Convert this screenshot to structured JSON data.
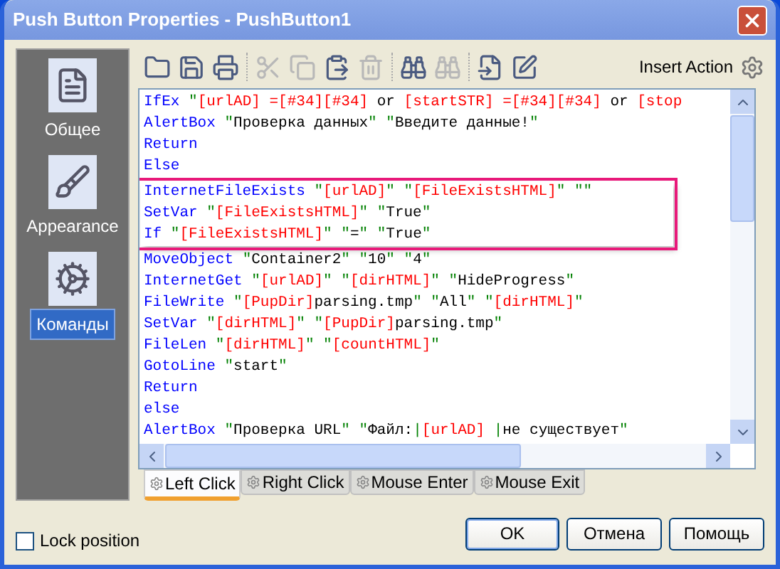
{
  "window": {
    "title": "Push Button Properties - PushButton1"
  },
  "sidebar": {
    "items": [
      {
        "label": "Общее",
        "kind": "general",
        "selected": false
      },
      {
        "label": "Appearance",
        "kind": "appearance",
        "selected": false
      },
      {
        "label": "Команды",
        "kind": "commands",
        "selected": true
      }
    ]
  },
  "toolbar": {
    "tools": [
      {
        "kind": "open",
        "disabled": false
      },
      {
        "kind": "save",
        "disabled": false
      },
      {
        "kind": "print",
        "disabled": false
      },
      {
        "kind": "sep"
      },
      {
        "kind": "cut",
        "disabled": true
      },
      {
        "kind": "copy",
        "disabled": true
      },
      {
        "kind": "paste",
        "disabled": false
      },
      {
        "kind": "delete",
        "disabled": true
      },
      {
        "kind": "sep"
      },
      {
        "kind": "find",
        "disabled": false
      },
      {
        "kind": "replace",
        "disabled": true
      },
      {
        "kind": "sep"
      },
      {
        "kind": "insert",
        "disabled": false
      },
      {
        "kind": "edit",
        "disabled": false
      }
    ],
    "insert_action": "Insert Action"
  },
  "editor": {
    "lines": [
      {
        "highlighted": false,
        "tokens": [
          {
            "kind": "kw",
            "text": "IfEx "
          },
          {
            "kind": "q",
            "text": "\""
          },
          {
            "kind": "v",
            "text": "[urlAD] =[#34][#34] "
          },
          {
            "kind": "t",
            "text": "or "
          },
          {
            "kind": "v",
            "text": "[startSTR] =[#34][#34] "
          },
          {
            "kind": "t",
            "text": "or "
          },
          {
            "kind": "v",
            "text": "[stop"
          }
        ]
      },
      {
        "highlighted": false,
        "tokens": [
          {
            "kind": "kw",
            "text": "AlertBox "
          },
          {
            "kind": "q",
            "text": "\""
          },
          {
            "kind": "t",
            "text": "Проверка данных"
          },
          {
            "kind": "q",
            "text": "\" \""
          },
          {
            "kind": "t",
            "text": "Введите данные!"
          },
          {
            "kind": "q",
            "text": "\""
          }
        ]
      },
      {
        "highlighted": false,
        "tokens": [
          {
            "kind": "kw",
            "text": "Return"
          }
        ]
      },
      {
        "highlighted": false,
        "tokens": [
          {
            "kind": "kw",
            "text": "Else"
          }
        ]
      },
      {
        "highlighted": true,
        "tokens": [
          {
            "kind": "kw",
            "text": "InternetFileExists "
          },
          {
            "kind": "q",
            "text": "\""
          },
          {
            "kind": "v",
            "text": "[urlAD]"
          },
          {
            "kind": "q",
            "text": "\" \""
          },
          {
            "kind": "v",
            "text": "[FileExistsHTML]"
          },
          {
            "kind": "q",
            "text": "\" \"\""
          }
        ]
      },
      {
        "highlighted": true,
        "tokens": [
          {
            "kind": "kw",
            "text": "SetVar "
          },
          {
            "kind": "q",
            "text": "\""
          },
          {
            "kind": "v",
            "text": "[FileExistsHTML]"
          },
          {
            "kind": "q",
            "text": "\" \""
          },
          {
            "kind": "t",
            "text": "True"
          },
          {
            "kind": "q",
            "text": "\""
          }
        ]
      },
      {
        "highlighted": true,
        "tokens": [
          {
            "kind": "kw",
            "text": "If "
          },
          {
            "kind": "q",
            "text": "\""
          },
          {
            "kind": "v",
            "text": "[FileExistsHTML]"
          },
          {
            "kind": "q",
            "text": "\" \""
          },
          {
            "kind": "t",
            "text": "="
          },
          {
            "kind": "q",
            "text": "\" \""
          },
          {
            "kind": "t",
            "text": "True"
          },
          {
            "kind": "q",
            "text": "\""
          }
        ]
      },
      {
        "highlighted": false,
        "tokens": [
          {
            "kind": "kw",
            "text": "MoveObject "
          },
          {
            "kind": "q",
            "text": "\""
          },
          {
            "kind": "t",
            "text": "Container2"
          },
          {
            "kind": "q",
            "text": "\" \""
          },
          {
            "kind": "t",
            "text": "10"
          },
          {
            "kind": "q",
            "text": "\" \""
          },
          {
            "kind": "t",
            "text": "4"
          },
          {
            "kind": "q",
            "text": "\""
          }
        ]
      },
      {
        "highlighted": false,
        "tokens": [
          {
            "kind": "kw",
            "text": "InternetGet "
          },
          {
            "kind": "q",
            "text": "\""
          },
          {
            "kind": "v",
            "text": "[urlAD]"
          },
          {
            "kind": "q",
            "text": "\" \""
          },
          {
            "kind": "v",
            "text": "[dirHTML]"
          },
          {
            "kind": "q",
            "text": "\" \""
          },
          {
            "kind": "t",
            "text": "HideProgress"
          },
          {
            "kind": "q",
            "text": "\""
          }
        ]
      },
      {
        "highlighted": false,
        "tokens": [
          {
            "kind": "kw",
            "text": "FileWrite "
          },
          {
            "kind": "q",
            "text": "\""
          },
          {
            "kind": "v",
            "text": "[PupDir]"
          },
          {
            "kind": "t",
            "text": "parsing.tmp"
          },
          {
            "kind": "q",
            "text": "\" \""
          },
          {
            "kind": "t",
            "text": "All"
          },
          {
            "kind": "q",
            "text": "\" \""
          },
          {
            "kind": "v",
            "text": "[dirHTML]"
          },
          {
            "kind": "q",
            "text": "\""
          }
        ]
      },
      {
        "highlighted": false,
        "tokens": [
          {
            "kind": "kw",
            "text": "SetVar "
          },
          {
            "kind": "q",
            "text": "\""
          },
          {
            "kind": "v",
            "text": "[dirHTML]"
          },
          {
            "kind": "q",
            "text": "\" \""
          },
          {
            "kind": "v",
            "text": "[PupDir]"
          },
          {
            "kind": "t",
            "text": "parsing.tmp"
          },
          {
            "kind": "q",
            "text": "\""
          }
        ]
      },
      {
        "highlighted": false,
        "tokens": [
          {
            "kind": "kw",
            "text": "FileLen "
          },
          {
            "kind": "q",
            "text": "\""
          },
          {
            "kind": "v",
            "text": "[dirHTML]"
          },
          {
            "kind": "q",
            "text": "\" \""
          },
          {
            "kind": "v",
            "text": "[countHTML]"
          },
          {
            "kind": "q",
            "text": "\""
          }
        ]
      },
      {
        "highlighted": false,
        "tokens": [
          {
            "kind": "kw",
            "text": "GotoLine "
          },
          {
            "kind": "q",
            "text": "\""
          },
          {
            "kind": "t",
            "text": "start"
          },
          {
            "kind": "q",
            "text": "\""
          }
        ]
      },
      {
        "highlighted": false,
        "tokens": [
          {
            "kind": "kw",
            "text": "Return"
          }
        ]
      },
      {
        "highlighted": false,
        "tokens": [
          {
            "kind": "kw",
            "text": "else"
          }
        ]
      },
      {
        "highlighted": false,
        "tokens": [
          {
            "kind": "kw",
            "text": "AlertBox "
          },
          {
            "kind": "q",
            "text": "\""
          },
          {
            "kind": "t",
            "text": "Проверка URL"
          },
          {
            "kind": "q",
            "text": "\" \""
          },
          {
            "kind": "t",
            "text": "Файл:"
          },
          {
            "kind": "q",
            "text": "|"
          },
          {
            "kind": "v",
            "text": "[urlAD] "
          },
          {
            "kind": "q",
            "text": "|"
          },
          {
            "kind": "t",
            "text": "не существует"
          },
          {
            "kind": "q",
            "text": "\""
          }
        ]
      }
    ]
  },
  "event_tabs": [
    {
      "label": "Left Click",
      "selected": true
    },
    {
      "label": "Right Click",
      "selected": false
    },
    {
      "label": "Mouse Enter",
      "selected": false
    },
    {
      "label": "Mouse Exit",
      "selected": false
    }
  ],
  "lock_position": {
    "label": "Lock position",
    "checked": false
  },
  "buttons": [
    {
      "label": "OK",
      "default": true
    },
    {
      "label": "Отмена",
      "default": false
    },
    {
      "label": "Помощь",
      "default": false
    }
  ]
}
